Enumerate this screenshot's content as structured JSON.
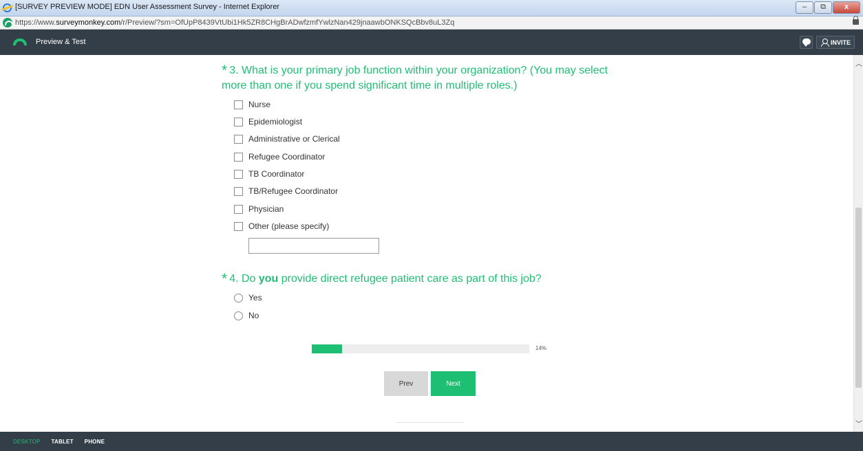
{
  "window": {
    "title": "[SURVEY PREVIEW MODE] EDN User Assessment Survey - Internet Explorer",
    "controls": {
      "minimize": "–",
      "restore": "⧉",
      "close": "x"
    }
  },
  "address_bar": {
    "url_prefix": "https://www.",
    "url_host": "surveymonkey.com",
    "url_path": "/r/Preview/?sm=OfUpP8439VtUbi1Hk5ZR8CHgBrADwfzmfYwlzNan429jnaawbONKSQcBbv8uL3Zq"
  },
  "preview_header": {
    "title": "Preview & Test",
    "invite_label": "INVITE"
  },
  "survey": {
    "q3": {
      "star": "*",
      "text": "3. What is your primary job function within your organization? (You may select more than one if you spend significant time in multiple roles.)",
      "options": [
        "Nurse",
        "Epidemiologist",
        "Administrative or Clerical",
        "Refugee Coordinator",
        "TB Coordinator",
        "TB/Refugee Coordinator",
        "Physician",
        "Other (please specify)"
      ],
      "other_value": ""
    },
    "q4": {
      "star": "*",
      "text_before": "4. Do ",
      "text_bold": "you",
      "text_after": " provide direct refugee patient care as part of this job?",
      "options": [
        "Yes",
        "No"
      ]
    },
    "progress": {
      "percent": 14,
      "label": "14%"
    },
    "buttons": {
      "prev": "Prev",
      "next": "Next"
    }
  },
  "footer": {
    "modes": [
      "DESKTOP",
      "TABLET",
      "PHONE"
    ],
    "active_mode": "DESKTOP"
  },
  "colors": {
    "accent": "#1fbf73",
    "header_bg": "#333e48"
  }
}
